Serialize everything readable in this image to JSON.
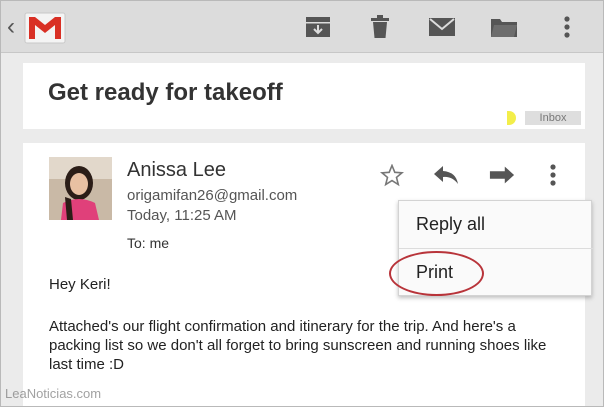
{
  "actionbar": {
    "icons": [
      "back-chevron-icon",
      "gmail-logo-icon",
      "archive-icon",
      "trash-icon",
      "mark-unread-icon",
      "move-to-folder-icon",
      "overflow-menu-icon"
    ]
  },
  "subject": {
    "title": "Get ready for takeoff",
    "label": "Inbox",
    "label_color": "#f3ee4a"
  },
  "message": {
    "sender_name": "Anissa Lee",
    "sender_email": "origamifan26@gmail.com",
    "time": "Today, 11:25 AM",
    "to": "To: me",
    "greeting": "Hey Keri!",
    "body": "Attached's our flight confirmation and itinerary for the trip. And here's a packing list so we don't all forget to bring sunscreen and running shoes like last time :D"
  },
  "menu": {
    "items": [
      {
        "label": "Reply all"
      },
      {
        "label": "Print"
      }
    ],
    "highlight_color": "#b8343a"
  },
  "watermark": "LeaNoticias.com"
}
